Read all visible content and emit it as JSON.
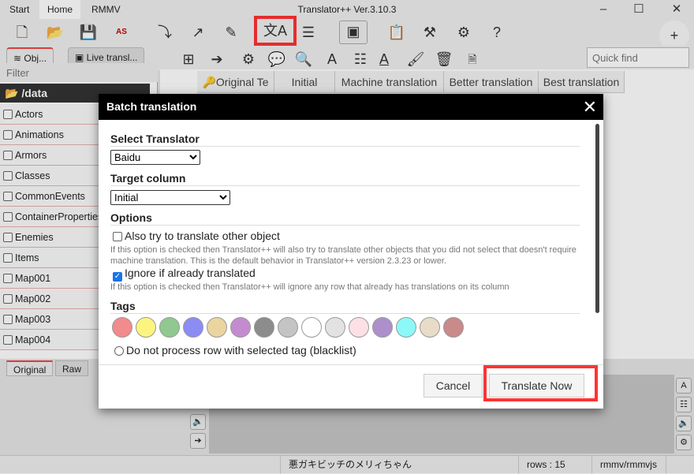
{
  "window": {
    "title": "Translator++ Ver.3.10.3",
    "menus": [
      "Start",
      "Home",
      "RMMV"
    ]
  },
  "toolbar": {
    "icons": [
      "new-project-icon",
      "open-icon",
      "save-icon",
      "save-as-icon",
      "import-icon",
      "export-icon",
      "inject-icon",
      "batch-translation-icon",
      "list-icon",
      "layout-icon",
      "clipboard-icon",
      "tools-icon",
      "settings-icon",
      "help-icon",
      "add-plugin-icon"
    ]
  },
  "tabs": {
    "objects": "Obj...",
    "live": "Live transl..."
  },
  "quick_find": {
    "placeholder": "Quick find"
  },
  "sidebar": {
    "filter_placeholder": "Filter",
    "root": "/data",
    "items": [
      "Actors",
      "Animations",
      "Armors",
      "Classes",
      "CommonEvents",
      "ContainerProperties",
      "Enemies",
      "Items",
      "Map001",
      "Map002",
      "Map003",
      "Map004"
    ]
  },
  "grid": {
    "columns": [
      "Original Te",
      "Initial",
      "Machine translation",
      "Better translation",
      "Best translation"
    ]
  },
  "bottom": {
    "tabs": [
      "Original",
      "Raw"
    ]
  },
  "status": {
    "name": "悪ガキビッチのメリィちゃん",
    "rows": "rows : 15",
    "engine": "rmmv/rmmvjs"
  },
  "dialog": {
    "title": "Batch translation",
    "select_translator_label": "Select Translator",
    "translator": "Baidu",
    "target_column_label": "Target column",
    "target_column": "Initial",
    "options_label": "Options",
    "opt1": {
      "label": "Also try to translate other object",
      "checked": false,
      "desc": "If this option is checked then Translator++ will also try to translate other objects that you did not select that doesn't require machine translation. This is the default behavior in Translator++ version 2.3.23 or lower."
    },
    "opt2": {
      "label": "Ignore if already translated",
      "checked": true,
      "desc": "If this option is checked then Translator++ will ignore any row that already has translations on its column"
    },
    "tags_label": "Tags",
    "tag_colors": [
      "#f28b8b",
      "#fbf580",
      "#8fc98f",
      "#8c8cf5",
      "#ead4a0",
      "#c58bd0",
      "#8c8c8c",
      "#c4c4c4",
      "#ffffff",
      "#e2e2e2",
      "#fde0e6",
      "#ad8fcb",
      "#8cf8f8",
      "#e8dcc8",
      "#c98a8a"
    ],
    "blacklist_label": "Do not process row with selected tag (blacklist)",
    "cancel": "Cancel",
    "translate": "Translate Now"
  },
  "colors": {
    "highlight": "#ff3333",
    "accent": "#e44444"
  }
}
